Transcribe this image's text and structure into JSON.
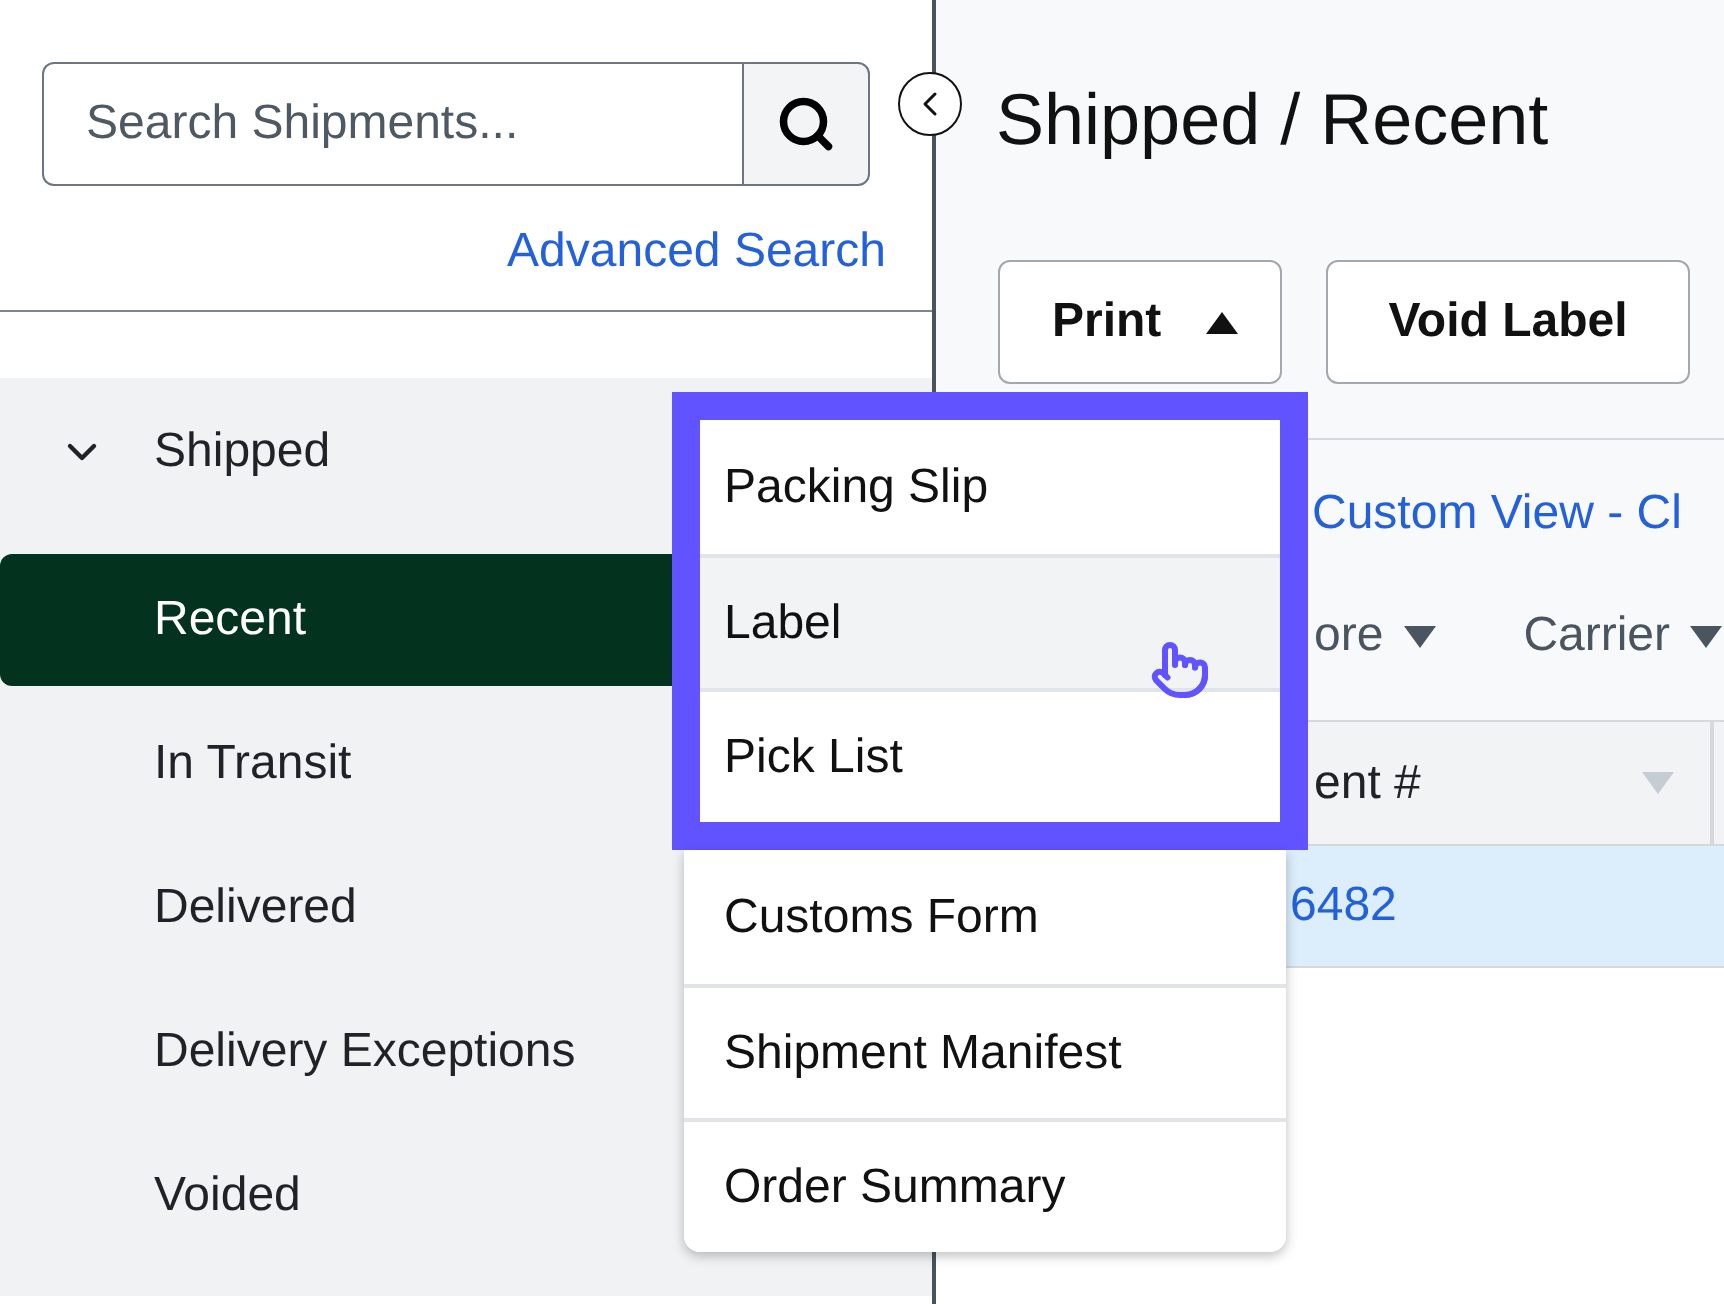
{
  "sidebar": {
    "search": {
      "placeholder": "Search Shipments..."
    },
    "advanced_search": "Advanced Search",
    "nav": [
      {
        "label": "Shipped",
        "expanded": true,
        "children": [
          {
            "label": "Recent",
            "selected": true
          },
          {
            "label": "In Transit",
            "selected": false
          },
          {
            "label": "Delivered",
            "selected": false
          },
          {
            "label": "Delivery Exceptions",
            "selected": false
          },
          {
            "label": "Voided",
            "selected": false
          }
        ]
      }
    ]
  },
  "main": {
    "title": "Shipped / Recent",
    "toolbar": [
      {
        "kind": "dropdown",
        "label": "Print",
        "expanded": true
      },
      {
        "kind": "button",
        "label": "Void Label"
      }
    ],
    "view_link": "Custom View - Cl",
    "filters": [
      {
        "label": "ore"
      },
      {
        "label": "Carrier"
      }
    ],
    "table": {
      "columns": [
        {
          "label": "ent #"
        }
      ],
      "rows": [
        {
          "selected": true,
          "cells": [
            "6482"
          ]
        }
      ]
    }
  },
  "print_menu": {
    "items": [
      {
        "label": "Packing Slip",
        "hovered": false,
        "highlighted": true
      },
      {
        "label": "Label",
        "hovered": true,
        "highlighted": true
      },
      {
        "label": "Pick List",
        "hovered": false,
        "highlighted": true
      },
      {
        "label": "Customs Form",
        "hovered": false,
        "highlighted": false
      },
      {
        "label": "Shipment Manifest",
        "hovered": false,
        "highlighted": false
      },
      {
        "label": "Order Summary",
        "hovered": false,
        "highlighted": false
      }
    ]
  }
}
